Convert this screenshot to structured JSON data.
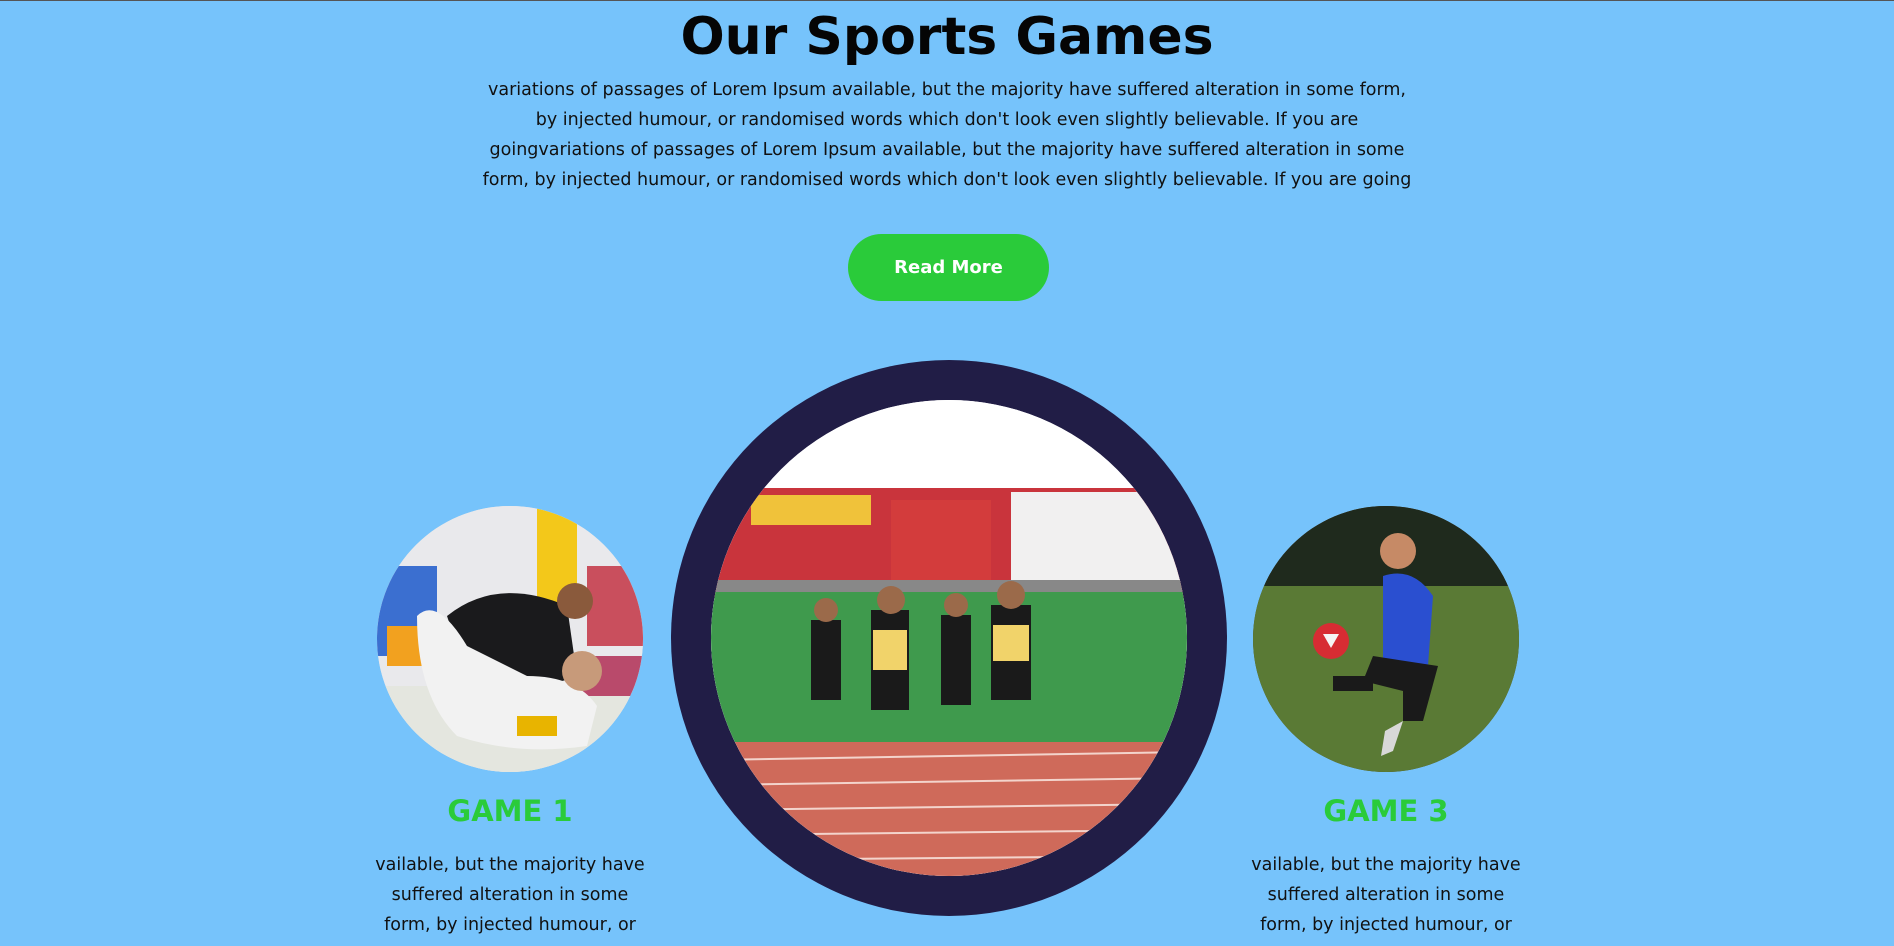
{
  "section": {
    "title": "Our Sports Games",
    "intro": "variations of passages of Lorem Ipsum available, but the majority have suffered alteration in some form, by injected humour, or randomised words which don't look even slightly believable. If you are goingvariations of passages of Lorem Ipsum available, but the majority have suffered alteration in some form, by injected humour, or randomised words which don't look even slightly believable. If you are going",
    "read_more_label": "Read More"
  },
  "games": [
    {
      "title": "GAME 1",
      "description": "vailable, but the majority have suffered alteration in some form, by injected humour, or",
      "image": "grappling-martial-arts-photo"
    },
    {
      "title": "",
      "description": "",
      "image": "sprint-race-track-photo"
    },
    {
      "title": "GAME 3",
      "description": "vailable, but the majority have suffered alteration in some form, by injected humour, or",
      "image": "soccer-juggling-photo"
    }
  ],
  "colors": {
    "background": "#76c3fb",
    "accent_green": "#2acb3a",
    "ring_navy": "#211d46"
  }
}
